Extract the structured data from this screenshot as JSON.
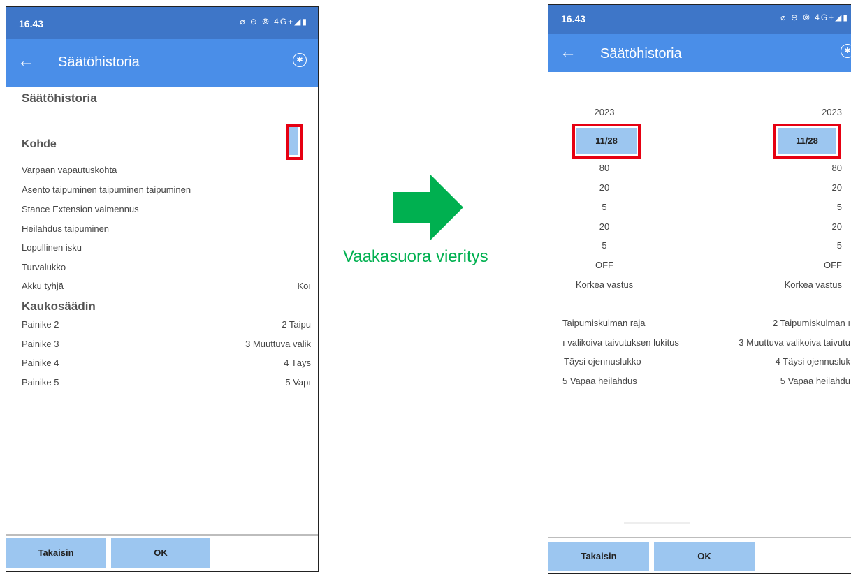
{
  "left": {
    "status": {
      "time": "16.43",
      "icons": "⌀ ⊖ ⦾ 4G+◢▮"
    },
    "appbar": {
      "title": "Säätöhistoria",
      "back_icon": "←",
      "bluetooth_icon": "bluetooth-icon"
    },
    "content_title": "Säätöhistoria",
    "section_kohde": "Kohde",
    "rows_kohde": [
      {
        "label": "Varpaan vapautuskohta",
        "value": ""
      },
      {
        "label": "Asento taipuminen taipuminen taipuminen",
        "value": ""
      },
      {
        "label": "Stance Extension vaimennus",
        "value": ""
      },
      {
        "label": "Heilahdus taipuminen",
        "value": ""
      },
      {
        "label": "Lopullinen isku",
        "value": ""
      },
      {
        "label": "Turvalukko",
        "value": ""
      },
      {
        "label": "Akku tyhjä",
        "value": "Koı"
      }
    ],
    "section_remote": "Kaukosäädin",
    "rows_remote": [
      {
        "label": "Painike 2",
        "value": "2 Taipu"
      },
      {
        "label": "Painike 3",
        "value": "3 Muuttuva valik"
      },
      {
        "label": "Painike 4",
        "value": "4 Täys"
      },
      {
        "label": "Painike 5",
        "value": "5 Vapı"
      }
    ],
    "footer": {
      "back": "Takaisin",
      "ok": "OK"
    }
  },
  "arrow": {
    "label": "Vaakasuora vieritys",
    "color": "#00b050"
  },
  "right": {
    "status": {
      "time": "16.43",
      "icons": "⌀ ⊖ ⦾ 4G+◢▮"
    },
    "appbar": {
      "title": "Säätöhistoria",
      "back_icon": "←",
      "bluetooth_icon": "bluetooth-icon"
    },
    "col1": {
      "year": "2023",
      "date": "11/28",
      "values": [
        "80",
        "20",
        "5",
        "20",
        "5",
        "OFF",
        "Korkea vastus"
      ],
      "remote": [
        "Taipumiskulman raja",
        "ı valikoiva taivutuksen lukitus",
        "Täysi ojennuslukko",
        "5 Vapaa heilahdus"
      ]
    },
    "col2": {
      "year": "2023",
      "date": "11/28",
      "values": [
        "80",
        "20",
        "5",
        "20",
        "5",
        "OFF",
        "Korkea vastus"
      ],
      "remote": [
        "2 Taipumiskulman ı",
        "3 Muuttuva valikoiva taivutu",
        "4 Täysi ojennusluk",
        "5 Vapaa heilahdu"
      ]
    },
    "footer": {
      "back": "Takaisin",
      "ok": "OK"
    }
  },
  "colors": {
    "status_bar": "#3e76c8",
    "app_bar": "#4a8ee8",
    "highlight": "#9cc6f0",
    "marker": "#e60012"
  }
}
